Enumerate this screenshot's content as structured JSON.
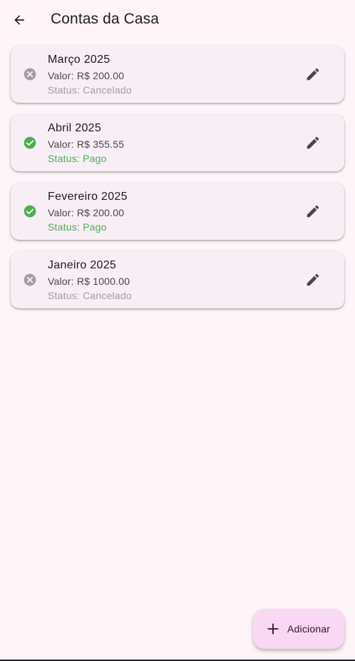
{
  "app_bar": {
    "back_icon": "arrow-back-icon",
    "title": "Contas da Casa"
  },
  "colors": {
    "background": "#fff5f8",
    "card": "#f7eef6",
    "paid": "#4caf50",
    "cancelled": "#9e9e9e",
    "fab": "#f8d8f3"
  },
  "bills": [
    {
      "month": "Março 2025",
      "value": "Valor: R$ 200.00",
      "status": "Status: Cancelado",
      "state": "cancelled",
      "status_icon": "cancel-circle-icon",
      "edit_icon": "pencil-icon"
    },
    {
      "month": "Abril 2025",
      "value": "Valor: R$ 355.55",
      "status": "Status: Pago",
      "state": "paid",
      "status_icon": "check-circle-icon",
      "edit_icon": "pencil-icon"
    },
    {
      "month": "Fevereiro 2025",
      "value": "Valor: R$ 200.00",
      "status": "Status: Pago",
      "state": "paid",
      "status_icon": "check-circle-icon",
      "edit_icon": "pencil-icon"
    },
    {
      "month": "Janeiro 2025",
      "value": "Valor: R$ 1000.00",
      "status": "Status: Cancelado",
      "state": "cancelled",
      "status_icon": "cancel-circle-icon",
      "edit_icon": "pencil-icon"
    }
  ],
  "fab": {
    "icon": "plus-icon",
    "label": "Adicionar"
  }
}
